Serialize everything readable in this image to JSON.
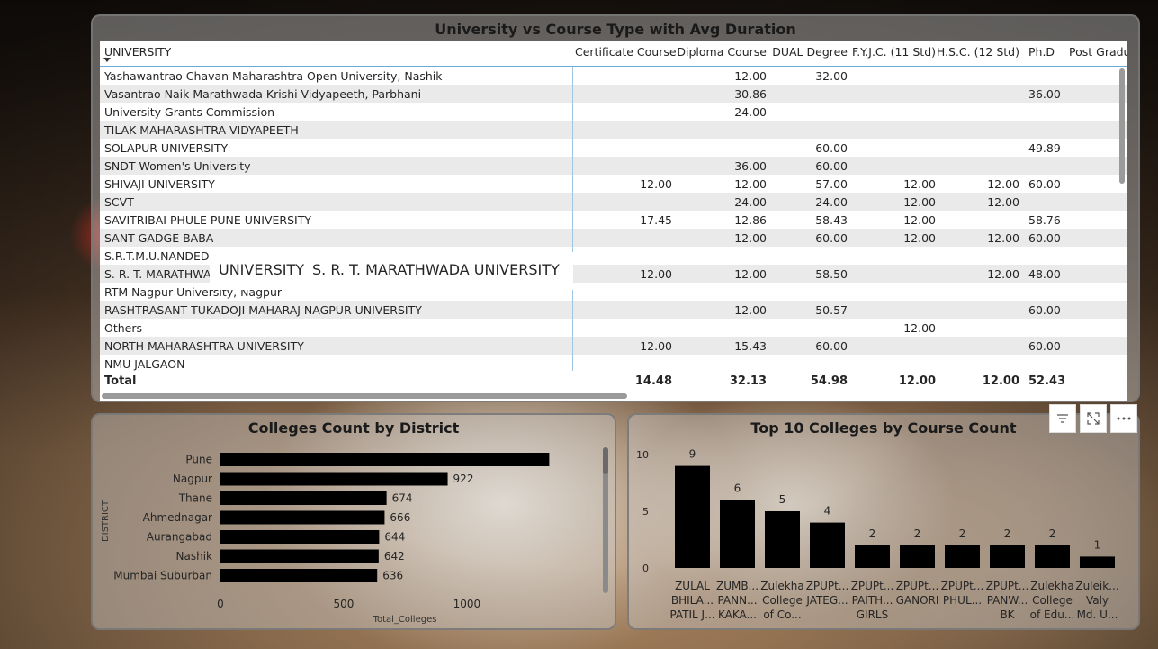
{
  "table": {
    "title": "University vs Course Type with Avg Duration",
    "columns": [
      "UNIVERSITY",
      "Certificate Course",
      "Diploma Course",
      "DUAL Degree",
      "F.Y.J.C. (11 Std)",
      "H.S.C. (12 Std)",
      "Ph.D",
      "Post Gradu"
    ],
    "rows": [
      [
        "Yashawantrao Chavan Maharashtra Open University, Nashik",
        "",
        "12.00",
        "32.00",
        "",
        "",
        ""
      ],
      [
        "Vasantrao Naik Marathwada Krishi Vidyapeeth, Parbhani",
        "",
        "30.86",
        "",
        "",
        "",
        "36.00"
      ],
      [
        "University Grants Commission",
        "",
        "24.00",
        "",
        "",
        "",
        ""
      ],
      [
        "TILAK MAHARASHTRA VIDYAPEETH",
        "",
        "",
        "",
        "",
        "",
        ""
      ],
      [
        "SOLAPUR UNIVERSITY",
        "",
        "",
        "60.00",
        "",
        "",
        "49.89"
      ],
      [
        "SNDT Women's University",
        "",
        "36.00",
        "60.00",
        "",
        "",
        ""
      ],
      [
        "SHIVAJI UNIVERSITY",
        "12.00",
        "12.00",
        "57.00",
        "12.00",
        "12.00",
        "60.00"
      ],
      [
        "SCVT",
        "",
        "24.00",
        "24.00",
        "12.00",
        "12.00",
        ""
      ],
      [
        "SAVITRIBAI PHULE PUNE UNIVERSITY",
        "17.45",
        "12.86",
        "58.43",
        "12.00",
        "",
        "58.76"
      ],
      [
        "SANT GADGE BABA",
        "",
        "12.00",
        "60.00",
        "12.00",
        "12.00",
        "60.00"
      ],
      [
        "S.R.T.M.U.NANDED",
        "",
        "",
        "",
        "",
        "",
        ""
      ],
      [
        "S. R. T. MARATHWA",
        "12.00",
        "12.00",
        "58.50",
        "",
        "12.00",
        "48.00"
      ],
      [
        "RTM Nagpur University, Nagpur",
        "",
        "",
        "",
        "",
        "",
        ""
      ],
      [
        "RASHTRASANT TUKADOJI MAHARAJ NAGPUR UNIVERSITY",
        "",
        "12.00",
        "50.57",
        "",
        "",
        "60.00"
      ],
      [
        "Others",
        "",
        "",
        "",
        "12.00",
        "",
        ""
      ],
      [
        "NORTH MAHARASHTRA UNIVERSITY",
        "12.00",
        "15.43",
        "60.00",
        "",
        "",
        "60.00"
      ],
      [
        "NMU JALGAON",
        "",
        "",
        "",
        "",
        "",
        ""
      ]
    ],
    "total": [
      "Total",
      "14.48",
      "32.13",
      "54.98",
      "12.00",
      "12.00",
      "52.43"
    ],
    "tooltip": {
      "label": "UNIVERSITY",
      "value": "S. R. T. MARATHWADA UNIVERSITY"
    }
  },
  "chart_data": [
    {
      "type": "bar",
      "orientation": "horizontal",
      "title": "Colleges Count by District",
      "categories": [
        "Pune",
        "Nagpur",
        "Thane",
        "Ahmednagar",
        "Aurangabad",
        "Nashik",
        "Mumbai Suburban"
      ],
      "values": [
        1334,
        922,
        674,
        666,
        644,
        642,
        636
      ],
      "data_labels": [
        "",
        "922",
        "674",
        "666",
        "644",
        "642",
        "636"
      ],
      "xlabel": "Total_Colleges",
      "ylabel": "DISTRICT",
      "xticks": [
        0,
        500,
        1000
      ],
      "xlim": [
        0,
        1380
      ],
      "color": "#000000"
    },
    {
      "type": "bar",
      "title": "Top 10 Colleges by Course Count",
      "categories": [
        [
          "ZULAL",
          "BHILA...",
          "PATIL J..."
        ],
        [
          "ZUMB...",
          "PANN...",
          "KAKA..."
        ],
        [
          "Zulekha",
          "College",
          "of Co..."
        ],
        [
          "ZPUPt...",
          "JATEG..."
        ],
        [
          "ZPUPt...",
          "PAITH...",
          "GIRLS"
        ],
        [
          "ZPUPt...",
          "GANORI"
        ],
        [
          "ZPUPt...",
          "PHUL..."
        ],
        [
          "ZPUPt...",
          "PANW...",
          "BK"
        ],
        [
          "Zulekha",
          "College",
          "of Edu..."
        ],
        [
          "Zuleik...",
          "Valy",
          "Md. U..."
        ]
      ],
      "values": [
        9,
        6,
        5,
        4,
        2,
        2,
        2,
        2,
        2,
        1
      ],
      "yticks": [
        0,
        5,
        10
      ],
      "ylim": [
        0,
        10
      ],
      "color": "#000000"
    }
  ]
}
